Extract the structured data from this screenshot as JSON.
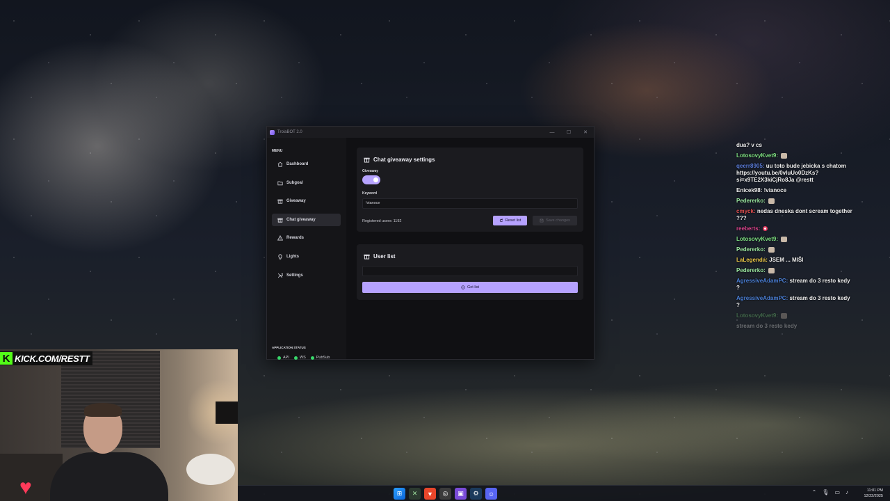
{
  "window": {
    "title": "TrolaBOT 2.0",
    "controls": {
      "minimize": "—",
      "maximize": "☐",
      "close": "✕"
    }
  },
  "sidebar": {
    "menu_heading": "MENU",
    "items": [
      {
        "label": "Dashboard",
        "icon": "home-icon",
        "active": false
      },
      {
        "label": "Subgoal",
        "icon": "folder-icon",
        "active": false
      },
      {
        "label": "Giveaway",
        "icon": "gift-icon",
        "active": false
      },
      {
        "label": "Chat giveaway",
        "icon": "gift-icon",
        "active": true
      },
      {
        "label": "Rewards",
        "icon": "alert-triangle-icon",
        "active": false
      },
      {
        "label": "Lights",
        "icon": "lightbulb-icon",
        "active": false
      },
      {
        "label": "Settings",
        "icon": "wrench-icon",
        "active": false
      }
    ],
    "status_heading": "APPLICATION STATUS",
    "statuses": [
      {
        "label": "API",
        "color": "#38d96b"
      },
      {
        "label": "WS",
        "color": "#38d96b"
      },
      {
        "label": "PubSub",
        "color": "#38d96b"
      }
    ]
  },
  "settings_card": {
    "title": "Chat giveaway settings",
    "giveaway_label": "Giveaway",
    "giveaway_enabled": true,
    "keyword_label": "Keyword",
    "keyword_value": "!vianoce",
    "registered_users": "Registered users: 1192",
    "reset_button": "Reset list",
    "save_button": "Save changes"
  },
  "user_list_card": {
    "title": "User list",
    "search_value": "",
    "get_list_button": "Get list"
  },
  "chat": [
    {
      "user": "",
      "message": "dua? v cs",
      "user_color": "#ffffff",
      "emote": false
    },
    {
      "user": "LotosovyKvet9:",
      "message": "",
      "user_color": "#7ee081",
      "emote": true
    },
    {
      "user": "qeerr8905:",
      "message": "uu toto bude jebicka s chatom https://youtu.be/0vIuUo0DzKs?si=x9TE2X3kiCjRo8Ja @restt",
      "user_color": "#5a7bd8",
      "emote": false
    },
    {
      "user": "Enicek98:",
      "message": "!vianoce",
      "user_color": "#f0f0f0",
      "emote": false
    },
    {
      "user": "Pedererko:",
      "message": "",
      "user_color": "#9be7a0",
      "emote": true
    },
    {
      "user": "cmyck:",
      "message": "nedas dneska dont scream together ???",
      "user_color": "#e04f4f",
      "emote": false
    },
    {
      "user": "reeberts:",
      "message": "",
      "user_color": "#e0458f",
      "emote": true,
      "emote_style": "dot"
    },
    {
      "user": "LotosovyKvet9:",
      "message": "",
      "user_color": "#7ee081",
      "emote": true
    },
    {
      "user": "Pedererko:",
      "message": "",
      "user_color": "#9be7a0",
      "emote": true
    },
    {
      "user": "LaLegenda:",
      "message": "JSEM ... MIŠI",
      "user_color": "#e8c547",
      "emote": false
    },
    {
      "user": "Pedererko:",
      "message": "",
      "user_color": "#9be7a0",
      "emote": true
    },
    {
      "user": "AgressiveAdamPC:",
      "message": "stream do 3 resto kedy ?",
      "user_color": "#4a7fd6",
      "emote": false
    },
    {
      "user": "AgressiveAdamPC:",
      "message": "stream do 3 resto kedy ?",
      "user_color": "#4a7fd6",
      "emote": false
    },
    {
      "user": "LotosovyKvet9:",
      "message": "",
      "user_color": "#7ee081",
      "emote": true,
      "faded": true
    },
    {
      "user": "",
      "message": "stream do 3 resto kedy",
      "user_color": "#888888",
      "emote": false,
      "faded": true
    }
  ],
  "overlay": {
    "kick_logo": "K",
    "kick_url": "KICK.COM/RESTT"
  },
  "taskbar": {
    "time": "11:01 PM",
    "date": "12/22/2025",
    "icons": [
      "windows-start-icon",
      "xbox-icon",
      "brave-icon",
      "chrome-icon",
      "twitch-icon",
      "steam-icon",
      "discord-icon"
    ]
  }
}
